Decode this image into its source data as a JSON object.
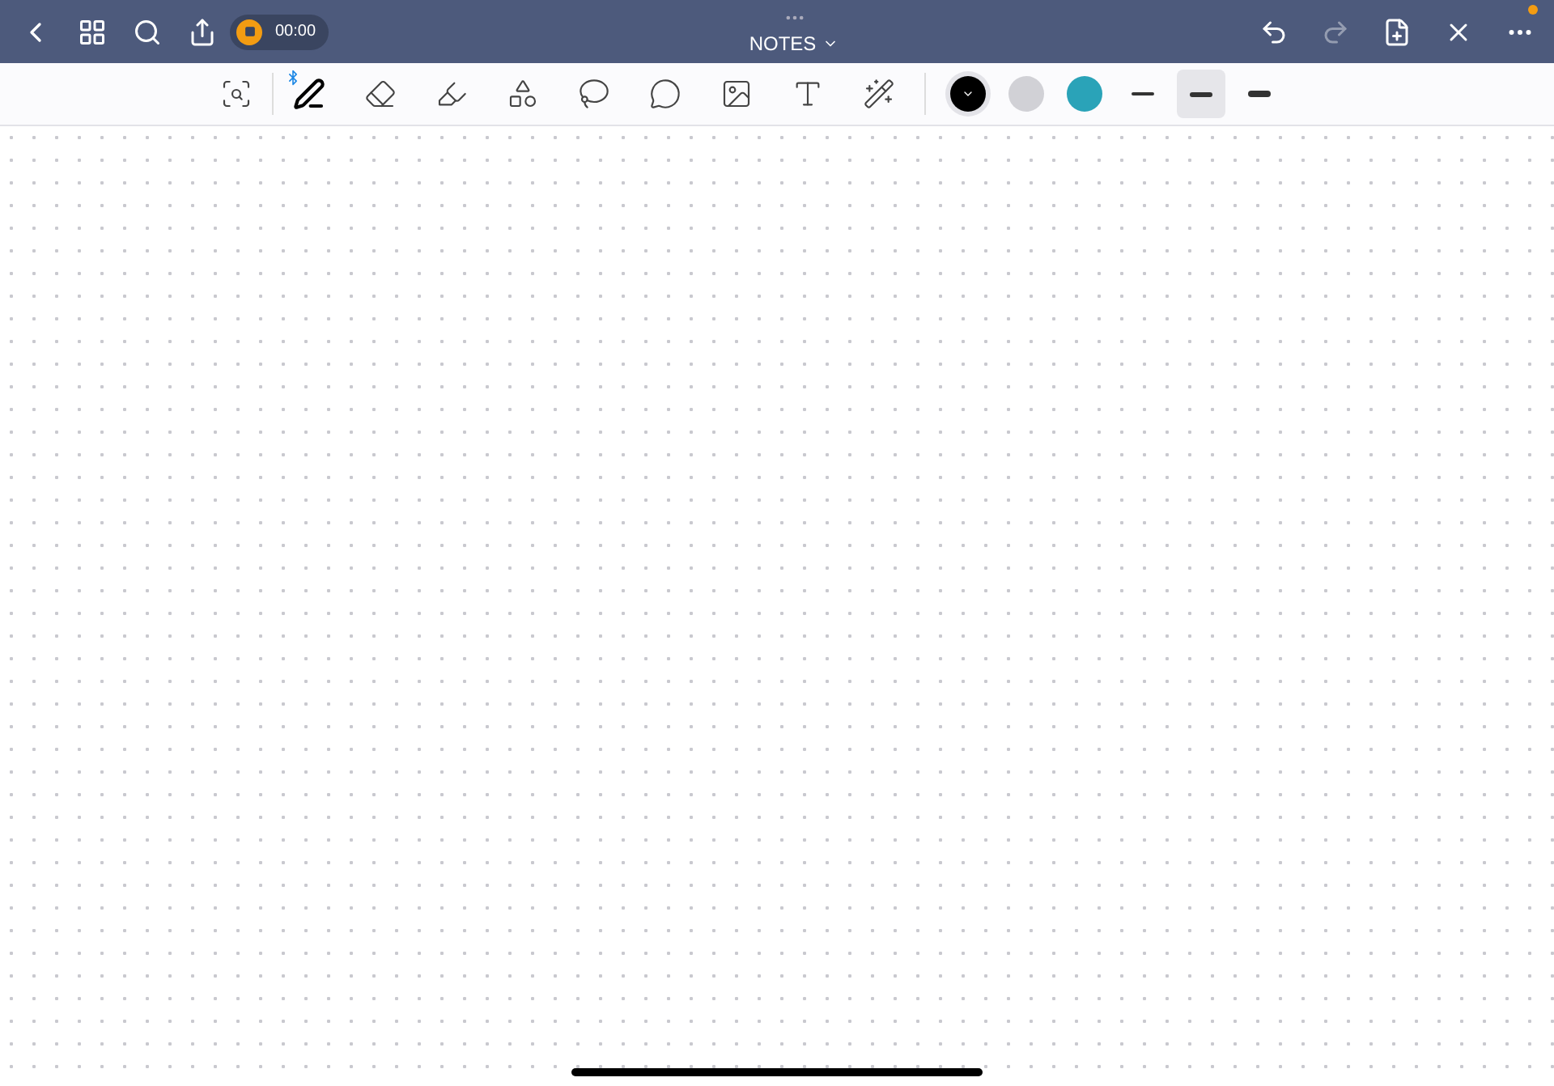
{
  "header": {
    "timer": "00:00",
    "title": "NOTES",
    "redo": {
      "disabled": true
    },
    "notification_dot": true
  },
  "tools": [
    {
      "kind": "zoom",
      "selected": false
    },
    {
      "kind": "pen",
      "selected": true
    },
    {
      "kind": "eraser",
      "selected": false
    },
    {
      "kind": "highlighter",
      "selected": false
    },
    {
      "kind": "shapes",
      "selected": false
    },
    {
      "kind": "lasso",
      "selected": false
    },
    {
      "kind": "sticker",
      "selected": false
    },
    {
      "kind": "image",
      "selected": false
    },
    {
      "kind": "text",
      "selected": false
    },
    {
      "kind": "laser",
      "selected": false
    }
  ],
  "colors": [
    {
      "color": "#000000",
      "selected": true
    },
    {
      "color": "#d1d1d6",
      "selected": false
    },
    {
      "color": "#2aa3b8",
      "selected": false
    }
  ],
  "widths": [
    {
      "kind": "thin",
      "selected": false
    },
    {
      "kind": "medium",
      "selected": true
    },
    {
      "kind": "thick",
      "selected": false
    }
  ]
}
